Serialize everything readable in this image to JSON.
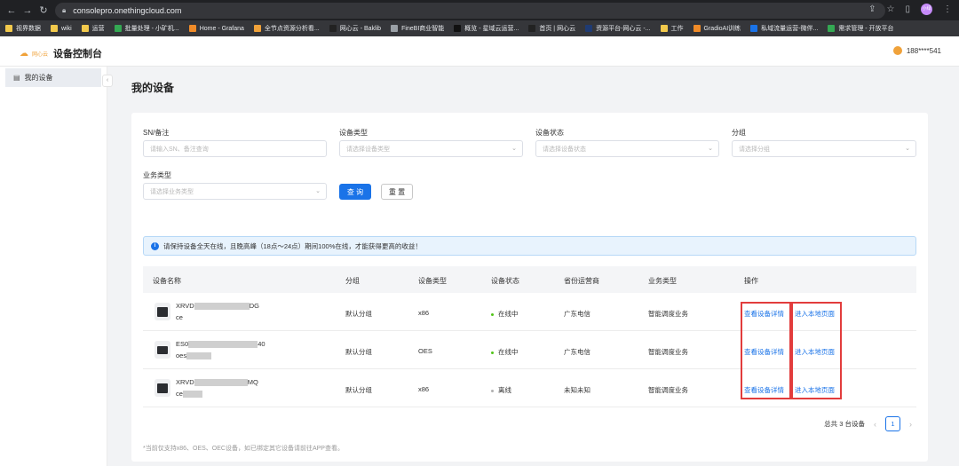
{
  "browser": {
    "url": "consolepro.onethingcloud.com",
    "profile_label": "小绿",
    "bookmarks": [
      {
        "label": "视界数据",
        "color": "#f2c94c"
      },
      {
        "label": "wiki",
        "color": "#f2c94c"
      },
      {
        "label": "运营",
        "color": "#f2c94c"
      },
      {
        "label": "批量处理 - 小矿机...",
        "color": "#34a853"
      },
      {
        "label": "Home - Grafana",
        "color": "#f08b28"
      },
      {
        "label": "全节点资源分析看...",
        "color": "#f0a23a"
      },
      {
        "label": "网心云 - Baklib",
        "color": "#222222"
      },
      {
        "label": "FineBI商业智能",
        "color": "#9aa0a6"
      },
      {
        "label": "概览 - 星域云运营...",
        "color": "#111111"
      },
      {
        "label": "首页 | 网心云",
        "color": "#222222"
      },
      {
        "label": "资源平台-网心云 -...",
        "color": "#1f3b73"
      },
      {
        "label": "工作",
        "color": "#f2c94c"
      },
      {
        "label": "GradioAI训练",
        "color": "#f08b28"
      },
      {
        "label": "私域流量运营-微伴...",
        "color": "#1a73e8"
      },
      {
        "label": "需求管理 - 开放平台",
        "color": "#34a853"
      }
    ]
  },
  "header": {
    "logo_text": "网心云",
    "title": "设备控制台",
    "user": "188****541"
  },
  "sidebar": {
    "items": [
      {
        "label": "我的设备",
        "icon": "grid-icon"
      }
    ]
  },
  "main": {
    "title": "我的设备",
    "filters": {
      "sn_label": "SN/备注",
      "sn_placeholder": "请输入SN、备注查询",
      "type_label": "设备类型",
      "type_placeholder": "请选择设备类型",
      "status_label": "设备状态",
      "status_placeholder": "请选择设备状态",
      "group_label": "分组",
      "group_placeholder": "请选择分组",
      "biz_label": "业务类型",
      "biz_placeholder": "请选择业务类型",
      "search_btn": "查 询",
      "reset_btn": "重 置"
    },
    "notice": "请保持设备全天在线，且晚高峰（18点～24点）期间100%在线，才能获得更高的收益！",
    "table": {
      "headers": [
        "设备名称",
        "分组",
        "设备类型",
        "设备状态",
        "省份运营商",
        "业务类型",
        "操作"
      ],
      "rows": [
        {
          "name_prefix": "XRVD",
          "name_suffix": "DG",
          "remark": "ce",
          "group": "默认分组",
          "type": "x86",
          "status": "在线中",
          "status_color": "#52c41a",
          "isp": "广东电信",
          "biz": "智能调度业务",
          "action1": "查看设备详情",
          "action2": "进入本地页面"
        },
        {
          "name_prefix": "ES0",
          "name_suffix": "40",
          "remark": "oes",
          "group": "默认分组",
          "type": "OES",
          "status": "在线中",
          "status_color": "#52c41a",
          "isp": "广东电信",
          "biz": "智能调度业务",
          "action1": "查看设备详情",
          "action2": "进入本地页面"
        },
        {
          "name_prefix": "XRVD",
          "name_suffix": "MQ",
          "remark": "ce",
          "group": "默认分组",
          "type": "x86",
          "status": "离线",
          "status_color": "#b0b0b0",
          "isp": "未知未知",
          "biz": "智能调度业务",
          "action1": "查看设备详情",
          "action2": "进入本地页面"
        }
      ]
    },
    "pagination": {
      "total_text": "总共 3 台设备",
      "current_page": "1"
    },
    "footer_note": "*当前仅支持x86、OES、OEC设备，如已绑定其它设备请前往APP查看。"
  }
}
